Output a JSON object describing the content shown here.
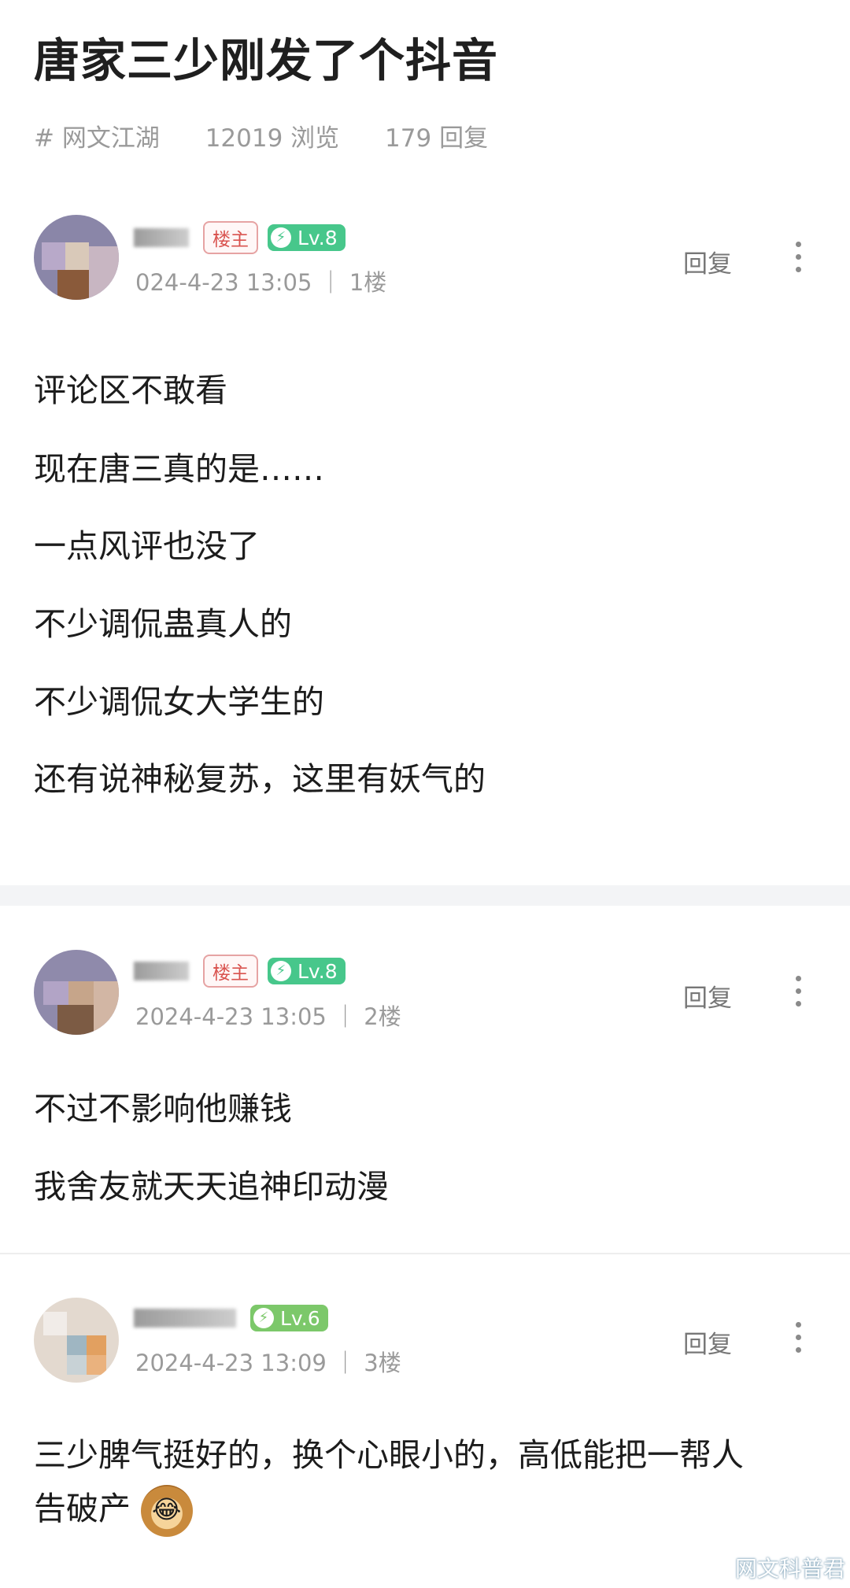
{
  "thread": {
    "title": "唐家三少刚发了个抖音",
    "tag": "# 网文江湖",
    "views": "12019 浏览",
    "replies": "179 回复"
  },
  "posts": [
    {
      "badge_op": "楼主",
      "level": "Lv.8",
      "time": "024-4-23 13:05 ｜ 1楼",
      "reply_label": "回复",
      "lines": [
        "评论区不敢看",
        "现在唐三真的是……",
        "一点风评也没了",
        "不少调侃蛊真人的",
        "不少调侃女大学生的",
        "还有说神秘复苏，这里有妖气的"
      ]
    },
    {
      "badge_op": "楼主",
      "level": "Lv.8",
      "time": "2024-4-23 13:05 ｜ 2楼",
      "reply_label": "回复",
      "lines": [
        "不过不影响他赚钱",
        "我舍友就天天追神印动漫"
      ]
    },
    {
      "level": "Lv.6",
      "time": "2024-4-23 13:09 ｜ 3楼",
      "reply_label": "回复",
      "lines": [
        "三少脾气挺好的，换个心眼小的，高低能把一帮人",
        "告破产"
      ]
    }
  ],
  "watermark": "网文科普君",
  "colors": {
    "op_badge": "#d9534f",
    "level_badge": "#47c78b",
    "level_badge_low": "#7cc86a",
    "meta_text": "#9a9a9a"
  }
}
